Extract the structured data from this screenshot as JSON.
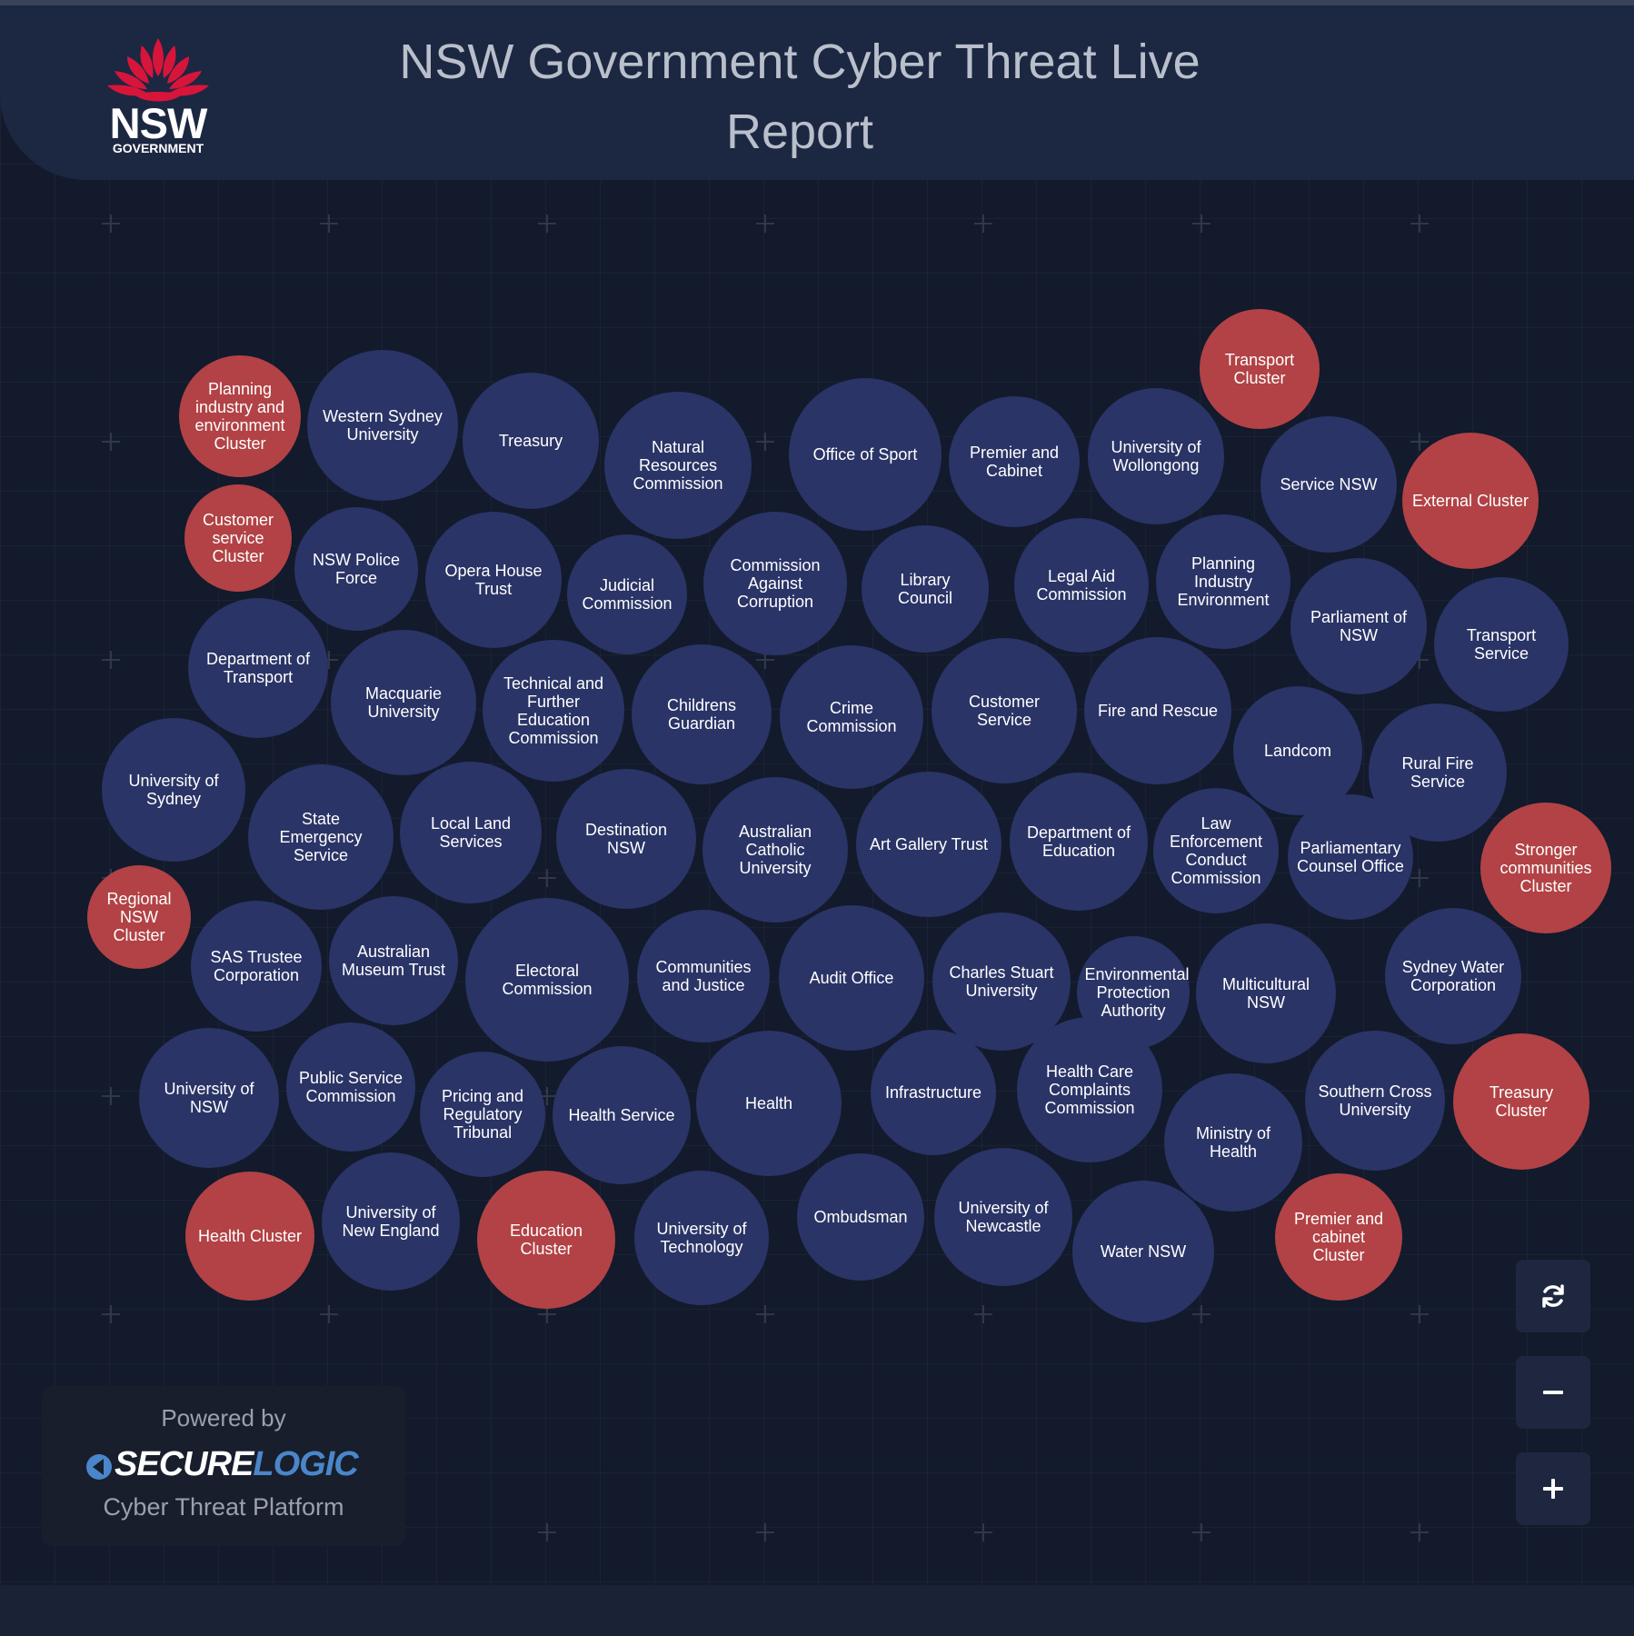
{
  "header": {
    "title": "NSW Government Cyber Threat Live Report",
    "logo": {
      "wordmark": "NSW",
      "subtext": "GOVERNMENT",
      "icon": "waratah-flower-icon",
      "color": "#d7153a"
    }
  },
  "colors": {
    "agency": "#2a3466",
    "cluster": "#b24245",
    "background": "#121a2c",
    "header": "#1c2742"
  },
  "bubbles": [
    {
      "label": "Transport Cluster",
      "kind": "cluster"
    },
    {
      "label": "Planning industry and environment Cluster",
      "kind": "cluster"
    },
    {
      "label": "Western Sydney University",
      "kind": "agency"
    },
    {
      "label": "Treasury",
      "kind": "agency"
    },
    {
      "label": "Natural Resources Commission",
      "kind": "agency"
    },
    {
      "label": "Office of Sport",
      "kind": "agency"
    },
    {
      "label": "Premier and Cabinet",
      "kind": "agency"
    },
    {
      "label": "University of Wollongong",
      "kind": "agency"
    },
    {
      "label": "Service NSW",
      "kind": "agency"
    },
    {
      "label": "External Cluster",
      "kind": "cluster"
    },
    {
      "label": "Customer service Cluster",
      "kind": "cluster"
    },
    {
      "label": "NSW Police Force",
      "kind": "agency"
    },
    {
      "label": "Opera House Trust",
      "kind": "agency"
    },
    {
      "label": "Judicial Commission",
      "kind": "agency"
    },
    {
      "label": "Commission Against Corruption",
      "kind": "agency"
    },
    {
      "label": "Library Council",
      "kind": "agency"
    },
    {
      "label": "Legal Aid Commission",
      "kind": "agency"
    },
    {
      "label": "Planning Industry Environment",
      "kind": "agency"
    },
    {
      "label": "Parliament of NSW",
      "kind": "agency"
    },
    {
      "label": "Transport Service",
      "kind": "agency"
    },
    {
      "label": "Department of Transport",
      "kind": "agency"
    },
    {
      "label": "Macquarie University",
      "kind": "agency"
    },
    {
      "label": "Technical and Further Education Commission",
      "kind": "agency"
    },
    {
      "label": "Childrens Guardian",
      "kind": "agency"
    },
    {
      "label": "Crime Commission",
      "kind": "agency"
    },
    {
      "label": "Customer Service",
      "kind": "agency"
    },
    {
      "label": "Fire and Rescue",
      "kind": "agency"
    },
    {
      "label": "Landcom",
      "kind": "agency"
    },
    {
      "label": "Rural Fire Service",
      "kind": "agency"
    },
    {
      "label": "University of Sydney",
      "kind": "agency"
    },
    {
      "label": "State Emergency Service",
      "kind": "agency"
    },
    {
      "label": "Local Land Services",
      "kind": "agency"
    },
    {
      "label": "Destination NSW",
      "kind": "agency"
    },
    {
      "label": "Australian Catholic University",
      "kind": "agency"
    },
    {
      "label": "Art Gallery Trust",
      "kind": "agency"
    },
    {
      "label": "Department of Education",
      "kind": "agency"
    },
    {
      "label": "Law Enforcement Conduct Commission",
      "kind": "agency"
    },
    {
      "label": "Parliamentary Counsel Office",
      "kind": "agency"
    },
    {
      "label": "Stronger communities Cluster",
      "kind": "cluster"
    },
    {
      "label": "Regional NSW Cluster",
      "kind": "cluster"
    },
    {
      "label": "SAS Trustee Corporation",
      "kind": "agency"
    },
    {
      "label": "Australian Museum Trust",
      "kind": "agency"
    },
    {
      "label": "Electoral Commission",
      "kind": "agency"
    },
    {
      "label": "Communities and Justice",
      "kind": "agency"
    },
    {
      "label": "Audit Office",
      "kind": "agency"
    },
    {
      "label": "Charles Stuart University",
      "kind": "agency"
    },
    {
      "label": "Environmental Protection Authority",
      "kind": "agency"
    },
    {
      "label": "Multicultural NSW",
      "kind": "agency"
    },
    {
      "label": "Sydney Water Corporation",
      "kind": "agency"
    },
    {
      "label": "University of NSW",
      "kind": "agency"
    },
    {
      "label": "Public Service Commission",
      "kind": "agency"
    },
    {
      "label": "Pricing and Regulatory Tribunal",
      "kind": "agency"
    },
    {
      "label": "Health Service",
      "kind": "agency"
    },
    {
      "label": "Health",
      "kind": "agency"
    },
    {
      "label": "Infrastructure",
      "kind": "agency"
    },
    {
      "label": "Health Care Complaints Commission",
      "kind": "agency"
    },
    {
      "label": "Ministry of Health",
      "kind": "agency"
    },
    {
      "label": "Southern Cross University",
      "kind": "agency"
    },
    {
      "label": "Treasury Cluster",
      "kind": "cluster"
    },
    {
      "label": "Health Cluster",
      "kind": "cluster"
    },
    {
      "label": "University of New England",
      "kind": "agency"
    },
    {
      "label": "Education Cluster",
      "kind": "cluster"
    },
    {
      "label": "University of Technology",
      "kind": "agency"
    },
    {
      "label": "Ombudsman",
      "kind": "agency"
    },
    {
      "label": "University of Newcastle",
      "kind": "agency"
    },
    {
      "label": "Water NSW",
      "kind": "agency"
    },
    {
      "label": "Premier and cabinet Cluster",
      "kind": "cluster"
    }
  ],
  "footer": {
    "powered_by": "Powered by",
    "brand_secure": "SECURE",
    "brand_logic": "LOGIC",
    "platform": "Cyber Threat Platform"
  },
  "controls": [
    {
      "name": "refresh",
      "icon": "refresh-icon"
    },
    {
      "name": "zoom-out",
      "icon": "minus-icon"
    },
    {
      "name": "zoom-in",
      "icon": "plus-icon"
    }
  ]
}
